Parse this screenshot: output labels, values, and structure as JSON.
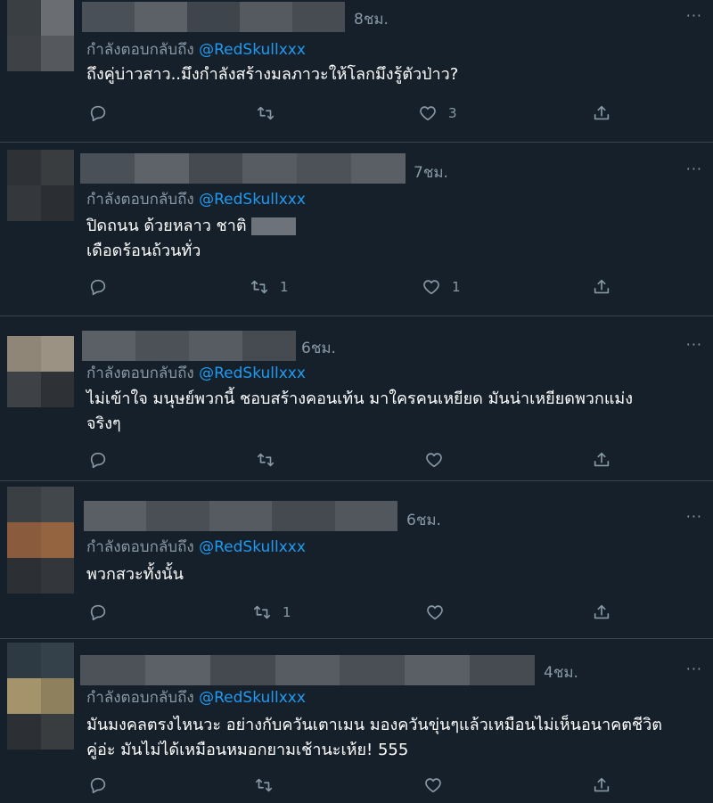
{
  "colors": {
    "background": "#15202b",
    "divider": "#38444d",
    "secondary_text": "#8899a6",
    "link": "#1d9bf0"
  },
  "icons": {
    "more": "more-dots-icon",
    "reply": "reply-icon",
    "retweet": "retweet-icon",
    "like": "like-icon",
    "share": "share-icon"
  },
  "tweets": [
    {
      "time": "8ชม.",
      "reply_prefix": "กำลังตอบกลับถึง",
      "reply_handle": "@RedSkullxxx",
      "text_lines": [
        "ถึงคู่บ่าวสาว..มึงกำลังสร้างมลภาวะให้โลกมึงรู้ตัวป่าว?"
      ],
      "retweets": "",
      "likes": "3",
      "more": "···"
    },
    {
      "time": "7ชม.",
      "reply_prefix": "กำลังตอบกลับถึง",
      "reply_handle": "@RedSkullxxx",
      "text_lines": [
        "ปิดถนน ด้วยหลาว ชาติ",
        "เดือดร้อนถ้วนทั่ว"
      ],
      "retweets": "1",
      "likes": "1",
      "more": "···"
    },
    {
      "time": "6ชม.",
      "reply_prefix": "กำลังตอบกลับถึง",
      "reply_handle": "@RedSkullxxx",
      "text_lines": [
        "ไม่เข้าใจ มนุษย์พวกนี้ ชอบสร้างคอนเท้น มาใครคนเหยียด มันน่าเหยียดพวกแม่ง",
        "จริงๆ"
      ],
      "retweets": "",
      "likes": "",
      "more": "···"
    },
    {
      "time": "6ชม.",
      "reply_prefix": "กำลังตอบกลับถึง",
      "reply_handle": "@RedSkullxxx",
      "text_lines": [
        "พวกสวะทั้งนั้น"
      ],
      "retweets": "1",
      "likes": "",
      "more": "···"
    },
    {
      "time": "4ชม.",
      "reply_prefix": "กำลังตอบกลับถึง",
      "reply_handle": "@RedSkullxxx",
      "text_lines": [
        "มันมงคลตรงไหนวะ อย่างกับควันเตาเมน มองควันขุ่นๆแล้วเหมือนไม่เห็นอนาคตชีวิต",
        "คู่อ่ะ มันไม่ได้เหมือนหมอกยามเช้านะเห้ย! 555"
      ],
      "retweets": "",
      "likes": "",
      "more": "···"
    }
  ]
}
